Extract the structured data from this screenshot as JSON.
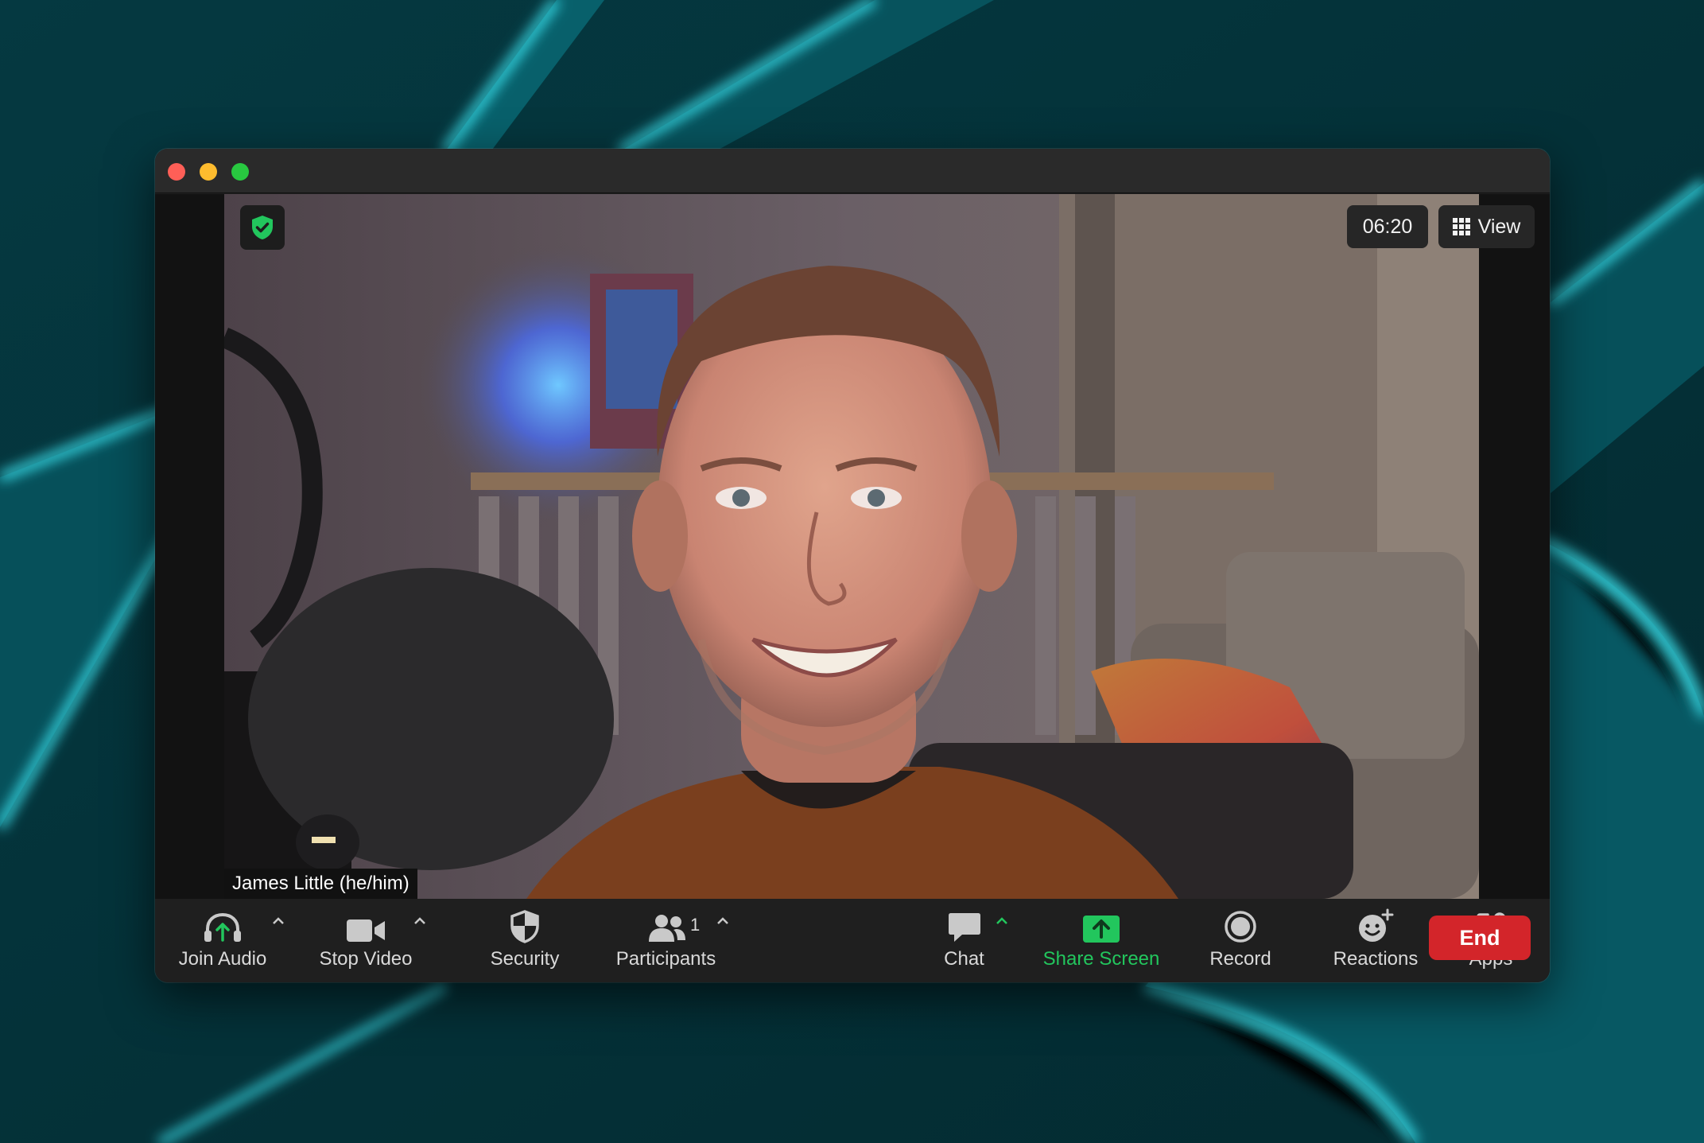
{
  "window": {
    "badge_icon": "shield-check-icon",
    "timer": "06:20",
    "view_label": "View"
  },
  "participant": {
    "name_tag": "James Little  (he/him)"
  },
  "toolbar": {
    "join_audio": "Join Audio",
    "stop_video": "Stop Video",
    "security": "Security",
    "participants": "Participants",
    "participants_count": "1",
    "chat": "Chat",
    "share_screen": "Share Screen",
    "record": "Record",
    "reactions": "Reactions",
    "apps": "Apps",
    "end": "End"
  },
  "colors": {
    "accent_green": "#22c65d",
    "end_red": "#d3252a",
    "wallpaper_teal": "#00e5ff"
  }
}
